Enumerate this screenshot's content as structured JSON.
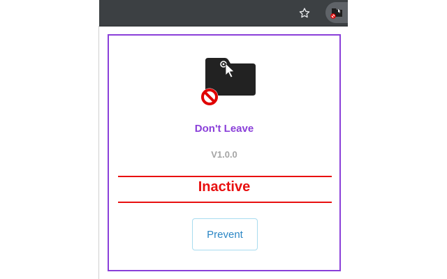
{
  "browser": {
    "toolbar_color": "#3c4043",
    "bookmark_icon": "star-icon",
    "extension_icon": "dont-leave-extension-icon"
  },
  "popup": {
    "app_icon": "folder-cursor-prohibited-icon",
    "app_name": "Don't Leave",
    "version": "V1.0.0",
    "status": "Inactive",
    "prevent_label": "Prevent",
    "colors": {
      "accent": "#8a3fd9",
      "status": "#e81010",
      "button_text": "#2b86c5",
      "version": "#a5a5a5"
    }
  }
}
